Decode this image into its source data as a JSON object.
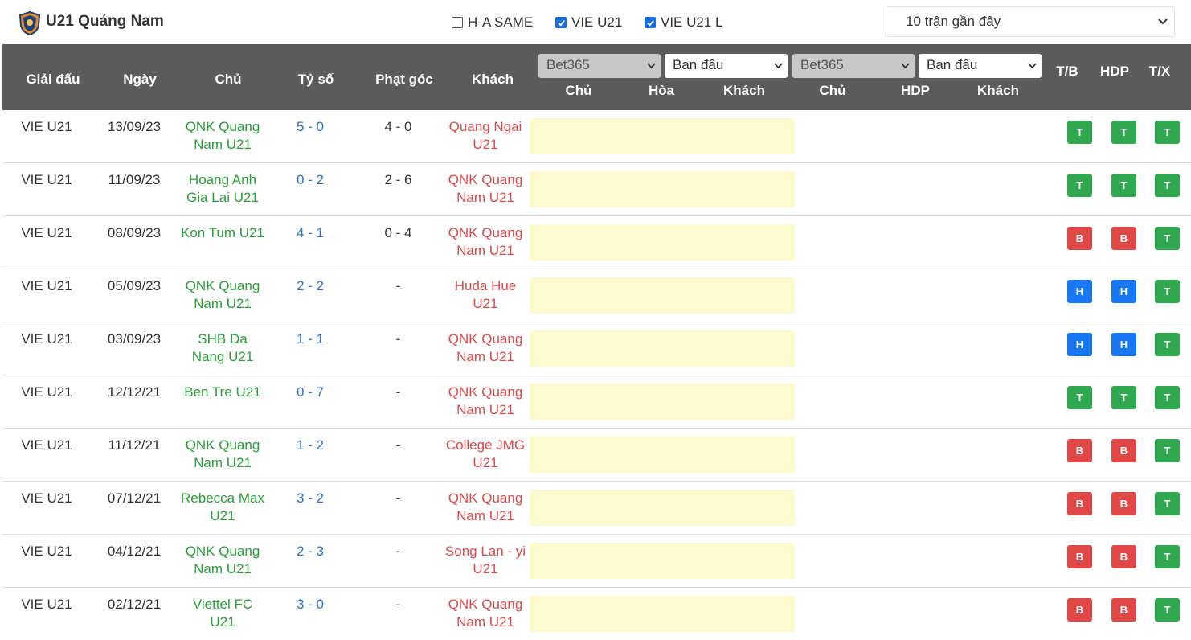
{
  "header": {
    "team_title": "U21 Quảng Nam",
    "filters": [
      {
        "label": "H-A SAME",
        "checked": false
      },
      {
        "label": "VIE U21",
        "checked": true
      },
      {
        "label": "VIE U21 L",
        "checked": true
      }
    ],
    "range_select": "10 trận gần đây"
  },
  "columns": {
    "league": "Giải đấu",
    "date": "Ngày",
    "home": "Chủ",
    "score": "Tỷ số",
    "corner": "Phạt góc",
    "away": "Khách",
    "tb": "T/B",
    "hdp": "HDP",
    "tx": "T/X"
  },
  "odds_group_1": {
    "bookmaker": "Bet365",
    "type": "Ban đầu",
    "sub": [
      "Chủ",
      "Hòa",
      "Khách"
    ]
  },
  "odds_group_2": {
    "bookmaker": "Bet365",
    "type": "Ban đầu",
    "sub": [
      "Chủ",
      "HDP",
      "Khách"
    ]
  },
  "result_colors": {
    "T": "#2fa84f",
    "B": "#e04848",
    "H": "#1877f2"
  },
  "matches": [
    {
      "league": "VIE U21",
      "date": "13/09/23",
      "home": [
        "QNK Quang",
        "Nam U21"
      ],
      "score": "5 - 0",
      "corner": "4 - 0",
      "away": [
        "Quang Ngai",
        "U21"
      ],
      "tb": "T",
      "hdp": "T",
      "tx": "T"
    },
    {
      "league": "VIE U21",
      "date": "11/09/23",
      "home": [
        "Hoang Anh",
        "Gia Lai U21"
      ],
      "score": "0 - 2",
      "corner": "2 - 6",
      "away": [
        "QNK Quang",
        "Nam U21"
      ],
      "tb": "T",
      "hdp": "T",
      "tx": "T"
    },
    {
      "league": "VIE U21",
      "date": "08/09/23",
      "home": [
        "Kon Tum U21",
        ""
      ],
      "score": "4 - 1",
      "corner": "0 - 4",
      "away": [
        "QNK Quang",
        "Nam U21"
      ],
      "tb": "B",
      "hdp": "B",
      "tx": "T"
    },
    {
      "league": "VIE U21",
      "date": "05/09/23",
      "home": [
        "QNK Quang",
        "Nam U21"
      ],
      "score": "2 - 2",
      "corner": "-",
      "away": [
        "Huda Hue",
        "U21"
      ],
      "tb": "H",
      "hdp": "H",
      "tx": "T"
    },
    {
      "league": "VIE U21",
      "date": "03/09/23",
      "home": [
        "SHB Da",
        "Nang U21"
      ],
      "score": "1 - 1",
      "corner": "-",
      "away": [
        "QNK Quang",
        "Nam U21"
      ],
      "tb": "H",
      "hdp": "H",
      "tx": "T"
    },
    {
      "league": "VIE U21",
      "date": "12/12/21",
      "home": [
        "Ben Tre U21",
        ""
      ],
      "score": "0 - 7",
      "corner": "-",
      "away": [
        "QNK Quang",
        "Nam U21"
      ],
      "tb": "T",
      "hdp": "T",
      "tx": "T"
    },
    {
      "league": "VIE U21",
      "date": "11/12/21",
      "home": [
        "QNK Quang",
        "Nam U21"
      ],
      "score": "1 - 2",
      "corner": "-",
      "away": [
        "College JMG",
        "U21"
      ],
      "tb": "B",
      "hdp": "B",
      "tx": "T"
    },
    {
      "league": "VIE U21",
      "date": "07/12/21",
      "home": [
        "Rebecca Max",
        "U21"
      ],
      "score": "3 - 2",
      "corner": "-",
      "away": [
        "QNK Quang",
        "Nam U21"
      ],
      "tb": "B",
      "hdp": "B",
      "tx": "T"
    },
    {
      "league": "VIE U21",
      "date": "04/12/21",
      "home": [
        "QNK Quang",
        "Nam U21"
      ],
      "score": "2 - 3",
      "corner": "-",
      "away": [
        "Song Lan - yi",
        "U21"
      ],
      "tb": "B",
      "hdp": "B",
      "tx": "T"
    },
    {
      "league": "VIE U21",
      "date": "02/12/21",
      "home": [
        "Viettel FC",
        "U21"
      ],
      "score": "3 - 0",
      "corner": "-",
      "away": [
        "QNK Quang",
        "Nam U21"
      ],
      "tb": "B",
      "hdp": "B",
      "tx": "T"
    }
  ]
}
